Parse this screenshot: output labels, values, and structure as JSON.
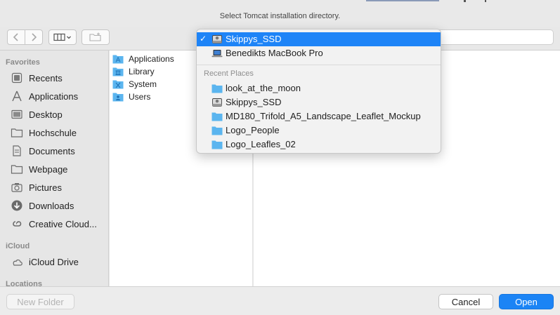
{
  "window": {
    "title": "Select Tomcat installation directory."
  },
  "toolbar": {
    "back_icon": "chevron-left-icon",
    "forward_icon": "chevron-right-icon",
    "view_icon": "column-view-icon",
    "new_folder_icon": "new-folder-icon"
  },
  "sidebar": {
    "sections": {
      "favorites": "Favorites",
      "icloud": "iCloud",
      "locations": "Locations"
    },
    "favorites": [
      {
        "label": "Recents",
        "icon": "clock-icon"
      },
      {
        "label": "Applications",
        "icon": "applications-icon"
      },
      {
        "label": "Desktop",
        "icon": "desktop-icon"
      },
      {
        "label": "Hochschule",
        "icon": "folder-icon"
      },
      {
        "label": "Documents",
        "icon": "document-icon"
      },
      {
        "label": "Webpage",
        "icon": "folder-icon"
      },
      {
        "label": "Pictures",
        "icon": "camera-icon"
      },
      {
        "label": "Downloads",
        "icon": "download-icon"
      },
      {
        "label": "Creative Cloud...",
        "icon": "creative-cloud-icon"
      }
    ],
    "icloud": [
      {
        "label": "iCloud Drive",
        "icon": "cloud-icon"
      }
    ]
  },
  "browser": {
    "column1": [
      {
        "label": "Applications",
        "icon": "applications-folder-icon"
      },
      {
        "label": "Library",
        "icon": "library-folder-icon"
      },
      {
        "label": "System",
        "icon": "system-folder-icon"
      },
      {
        "label": "Users",
        "icon": "users-folder-icon"
      }
    ]
  },
  "location_menu": {
    "selected_check": "✓",
    "devices": [
      {
        "label": "Skippys_SSD",
        "icon": "hard-drive-icon",
        "selected": true
      },
      {
        "label": "Benedikts MacBook Pro",
        "icon": "laptop-icon",
        "selected": false
      }
    ],
    "recent_header": "Recent Places",
    "recent": [
      {
        "label": "look_at_the_moon",
        "icon": "folder-icon"
      },
      {
        "label": "Skippys_SSD",
        "icon": "hard-drive-icon"
      },
      {
        "label": "MD180_Trifold_A5_Landscape_Leaflet_Mockup",
        "icon": "folder-icon"
      },
      {
        "label": "Logo_People",
        "icon": "folder-icon"
      },
      {
        "label": "Logo_Leafles_02",
        "icon": "folder-icon"
      }
    ]
  },
  "buttons": {
    "new_folder": "New Folder",
    "cancel": "Cancel",
    "open": "Open"
  },
  "colors": {
    "accent": "#1e84f7",
    "folder": "#5bb5ef",
    "sidebar_bg": "#e6e6e6"
  }
}
